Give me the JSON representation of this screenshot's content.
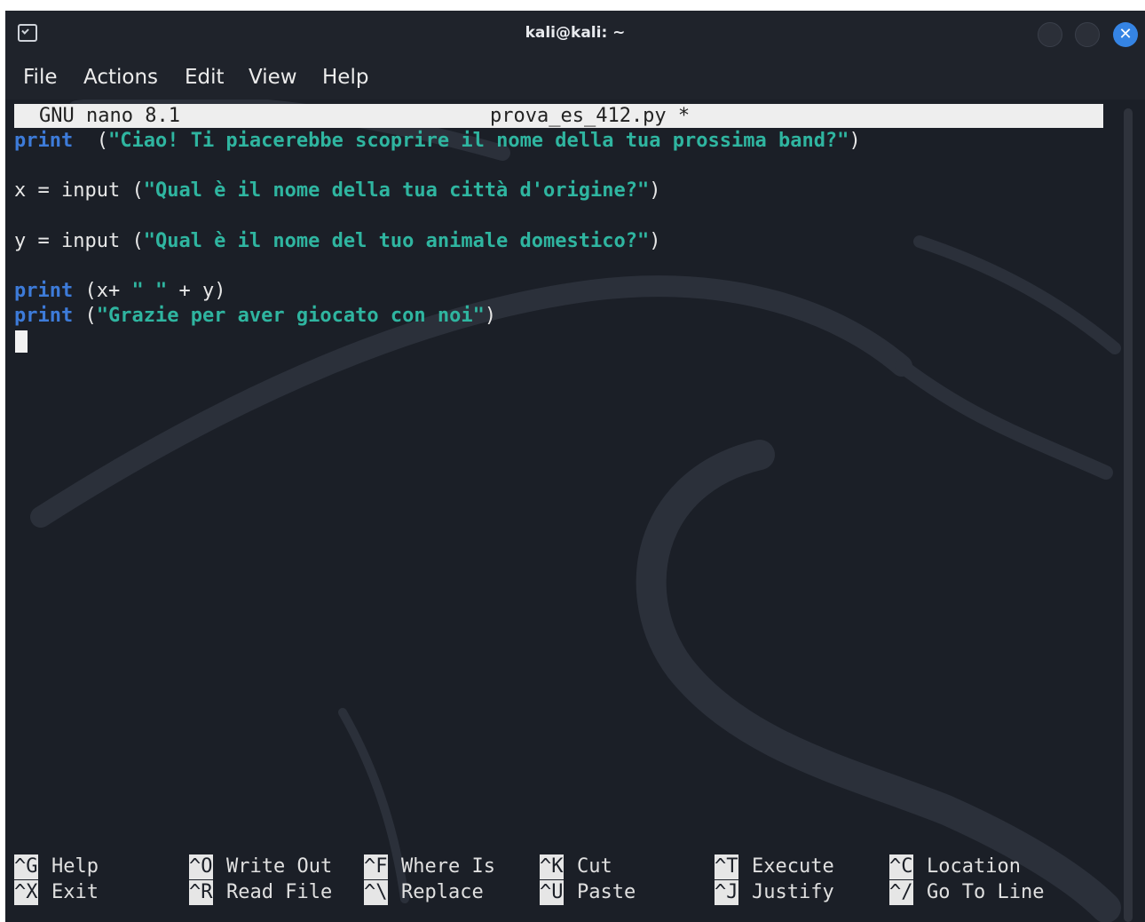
{
  "window": {
    "title": "kali@kali: ~",
    "close_glyph": "✕"
  },
  "menubar": {
    "items": [
      "File",
      "Actions",
      "Edit",
      "View",
      "Help"
    ]
  },
  "nano": {
    "version": "GNU nano 8.1",
    "filename": "prova_es_412.py *",
    "code": {
      "line1": {
        "kw": "print",
        "pre": "  (",
        "str": "\"Ciao! Ti piacerebbe scoprire il nome della tua prossima band?\"",
        "post": ")"
      },
      "line2": {
        "pre": "x = input (",
        "str": "\"Qual è il nome della tua città d'origine?\"",
        "post": ")"
      },
      "line3": {
        "pre": "y = input (",
        "str": "\"Qual è il nome del tuo animale domestico?\"",
        "post": ")"
      },
      "line4": {
        "kw": "print",
        "pre": " (x+ ",
        "str": "\" \"",
        "post": " + y)"
      },
      "line5": {
        "kw": "print",
        "pre": " (",
        "str": "\"Grazie per aver giocato con noi\"",
        "post": ")"
      }
    },
    "shortcuts": [
      {
        "key": "^G",
        "label": "Help"
      },
      {
        "key": "^X",
        "label": "Exit"
      },
      {
        "key": "^O",
        "label": "Write Out"
      },
      {
        "key": "^R",
        "label": "Read File"
      },
      {
        "key": "^F",
        "label": "Where Is"
      },
      {
        "key": "^\\",
        "label": "Replace"
      },
      {
        "key": "^K",
        "label": "Cut"
      },
      {
        "key": "^U",
        "label": "Paste"
      },
      {
        "key": "^T",
        "label": "Execute"
      },
      {
        "key": "^J",
        "label": "Justify"
      },
      {
        "key": "^C",
        "label": "Location"
      },
      {
        "key": "^/",
        "label": "Go To Line"
      }
    ]
  },
  "colors": {
    "keyword": "#3d7bd9",
    "string": "#2fb5a0",
    "close_button": "#3584e4"
  }
}
